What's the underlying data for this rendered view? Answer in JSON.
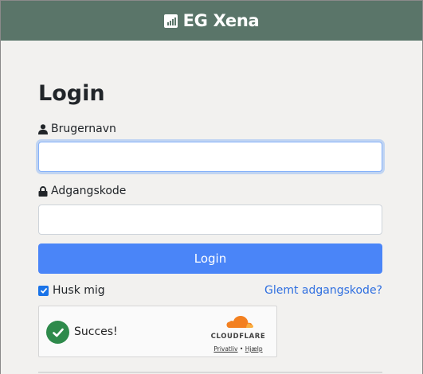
{
  "header": {
    "brand_name": "EG Xena",
    "brand_icon": "signal-bars-icon",
    "background": "#5a7569"
  },
  "login": {
    "title": "Login",
    "username_label": "Brugernavn",
    "username_value": "",
    "username_icon": "user-icon",
    "password_label": "Adgangskode",
    "password_value": "",
    "password_icon": "lock-icon",
    "submit_label": "Login",
    "remember_label": "Husk mig",
    "remember_checked": true,
    "forgot_label": "Glemt adgangskode?"
  },
  "captcha": {
    "status_text": "Succes!",
    "provider": "CLOUDFLARE",
    "privacy_label": "Privatliv",
    "separator": "•",
    "help_label": "Hjælp"
  },
  "colors": {
    "accent": "#4a85f8",
    "link": "#2f6fe0",
    "success": "#2e8a4b",
    "cloudflare_orange": "#f38020"
  }
}
